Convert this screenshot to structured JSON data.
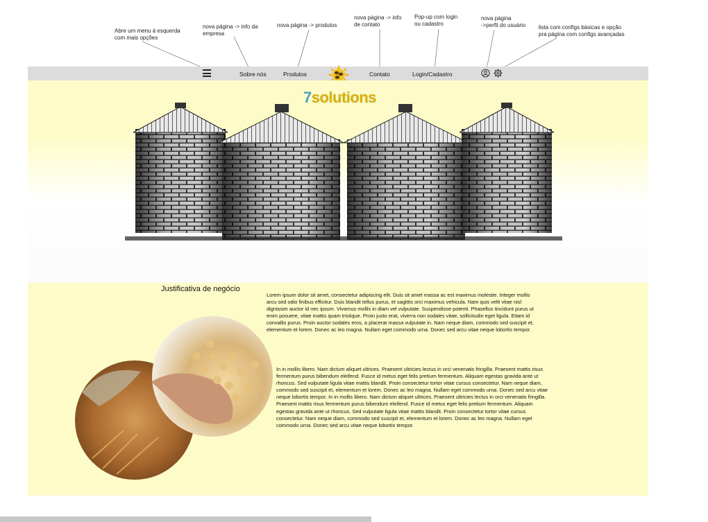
{
  "annotations": {
    "menu": "Abre um menu à esquerda\ncom mais opções",
    "about": "nova página -> info da\nempresa",
    "products": "nova página -> produtos",
    "contact": "nova página -> info\nde contato",
    "login": "Pop-up com login\nou cadastro",
    "profile": "nova página\n->perfil do usuário",
    "settings": "lista com configs básicas e opção\npra página com configs avançadas"
  },
  "nav": {
    "about": "Sobre nós",
    "products": "Produtos",
    "contact": "Contato",
    "login": "Login/Cadastro"
  },
  "brand": {
    "seven": "7",
    "rest": "solutions"
  },
  "content": {
    "title": "Justificativa de negócio",
    "paragraph1": "Lorem ipsum dolor sit amet, consectetur adipiscing elit. Duis sit amet massa ac est maximus molestie. Integer mollis arcu sed odio finibus efficitur. Duis blandit tellus purus, et sagittis orci maximus vehicula. Nam quis velit vitae nisl dignissim auctor id nec ipsum. Vivamus mollis in diam vel vulputate. Suspendisse potenti. Phasellus tincidunt purus ut enim posuere, vitae mattis quam tristique. Proin justo erat, viverra non sodales vitae, sollicitudin eget ligula. Etiam id convallis purus. Proin auctor sodales eros, a placerat massa vulputate in.  Nam neque diam, commodo sed suscipit et, elementum et lorem. Donec ac leo magna. Nullam eget commodo urna. Donec sed arcu vitae neque lobortis tempor.",
    "paragraph2": "In in mollis libero. Nam dictum aliquet ultrices. Praesent ultricies lectus in orci venenatis fringilla. Praesent mattis risus fermentum purus bibendum eleifend. Fusce id metus eget felis pretium fermentum. Aliquam egestas gravida ante ut rhoncus. Sed vulputate ligula vitae mattis blandit. Proin consectetur tortor vitae cursus consectetur. Nam neque diam, commodo sed suscipit et, elementum et lorem. Donec ac leo magna. Nullam eget commodo urna. Donec sed arcu vitae neque lobortis tempor. In in mollis libero. Nam dictum aliquet ultrices. Praesent ultricies lectus in orci venenatis fringilla. Praesent mattis risus fermentum purus bibendum eleifend. Fusce id metus eget felis pretium fermentum. Aliquam egestas gravida ante ut rhoncus. Sed vulputate ligula vitae mattis blandit. Proin consectetur tortor vitae cursus consectetur. Nam neque diam, commodo sed suscipit et, elementum et lorem. Donec ac leo magna. Nullam eget commodo urna. Donec sed arcu vitae neque lobortis tempor."
  },
  "icons": {
    "menu": "hamburger-menu-icon",
    "logo": "coffee-beans-sun-logo-icon",
    "profile": "user-profile-icon",
    "settings": "gear-icon"
  },
  "colors": {
    "navbar": "#dcdcdc",
    "page_bg": "#fdfcc8",
    "brand_seven": "#4aa3c8",
    "brand_rest": "#e0b000"
  }
}
